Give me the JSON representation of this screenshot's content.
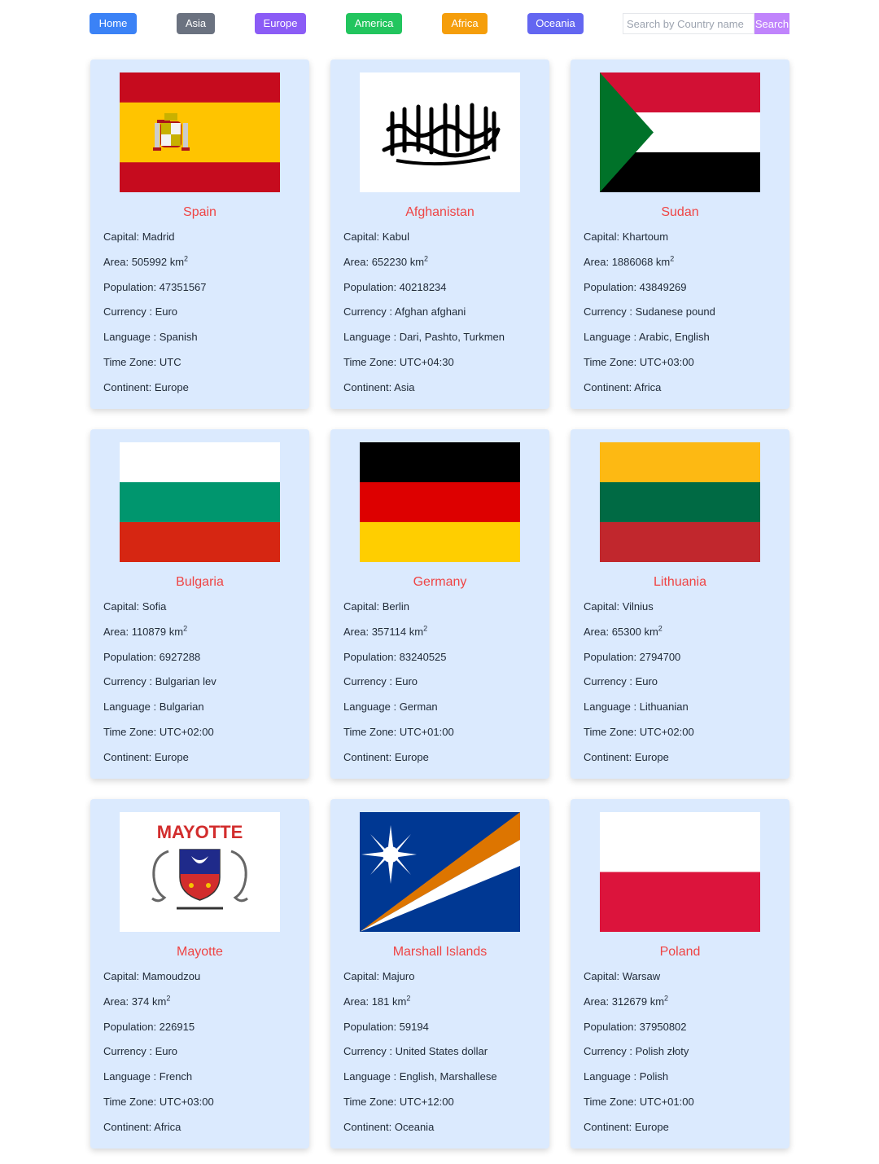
{
  "nav": {
    "buttons": [
      {
        "label": "Home",
        "color": "#3b82f6"
      },
      {
        "label": "Asia",
        "color": "#6b7280"
      },
      {
        "label": "Europe",
        "color": "#8b5cf6"
      },
      {
        "label": "America",
        "color": "#22c55e"
      },
      {
        "label": "Africa",
        "color": "#f59e0b"
      },
      {
        "label": "Oceania",
        "color": "#6366f1"
      }
    ],
    "search": {
      "placeholder": "Search by Country name",
      "button_label": "Search"
    }
  },
  "labels": {
    "capital": "Capital: ",
    "area": "Area: ",
    "area_unit": " km",
    "area_power": "2",
    "population": "Population: ",
    "currency": "Currency : ",
    "language": "Language : ",
    "timezone": "Time Zone: ",
    "continent": "Continent: "
  },
  "flag_texts": {
    "mayotte": "MAYOTTE"
  },
  "countries": [
    {
      "name": "Spain",
      "flag": "spain",
      "capital": "Madrid",
      "area": "505992",
      "population": "47351567",
      "currency": "Euro",
      "language": "Spanish",
      "timezone": "UTC",
      "continent": "Europe"
    },
    {
      "name": "Afghanistan",
      "flag": "afghanistan",
      "capital": "Kabul",
      "area": "652230",
      "population": "40218234",
      "currency": "Afghan afghani",
      "language": "Dari, Pashto, Turkmen",
      "timezone": "UTC+04:30",
      "continent": "Asia"
    },
    {
      "name": "Sudan",
      "flag": "sudan",
      "capital": "Khartoum",
      "area": "1886068",
      "population": "43849269",
      "currency": "Sudanese pound",
      "language": "Arabic, English",
      "timezone": "UTC+03:00",
      "continent": "Africa"
    },
    {
      "name": "Bulgaria",
      "flag": "bulgaria",
      "capital": "Sofia",
      "area": "110879",
      "population": "6927288",
      "currency": "Bulgarian lev",
      "language": "Bulgarian",
      "timezone": "UTC+02:00",
      "continent": "Europe"
    },
    {
      "name": "Germany",
      "flag": "germany",
      "capital": "Berlin",
      "area": "357114",
      "population": "83240525",
      "currency": "Euro",
      "language": "German",
      "timezone": "UTC+01:00",
      "continent": "Europe"
    },
    {
      "name": "Lithuania",
      "flag": "lithuania",
      "capital": "Vilnius",
      "area": "65300",
      "population": "2794700",
      "currency": "Euro",
      "language": "Lithuanian",
      "timezone": "UTC+02:00",
      "continent": "Europe"
    },
    {
      "name": "Mayotte",
      "flag": "mayotte",
      "capital": "Mamoudzou",
      "area": "374",
      "population": "226915",
      "currency": "Euro",
      "language": "French",
      "timezone": "UTC+03:00",
      "continent": "Africa"
    },
    {
      "name": "Marshall Islands",
      "flag": "marshall",
      "capital": "Majuro",
      "area": "181",
      "population": "59194",
      "currency": "United States dollar",
      "language": "English, Marshallese",
      "timezone": "UTC+12:00",
      "continent": "Oceania"
    },
    {
      "name": "Poland",
      "flag": "poland",
      "capital": "Warsaw",
      "area": "312679",
      "population": "37950802",
      "currency": "Polish złoty",
      "language": "Polish",
      "timezone": "UTC+01:00",
      "continent": "Europe"
    }
  ]
}
